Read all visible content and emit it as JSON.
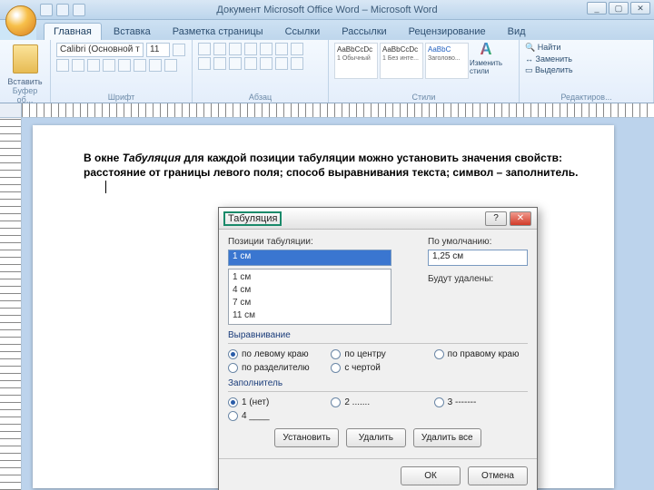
{
  "titlebar": {
    "text": "Документ Microsoft Office Word – Microsoft Word"
  },
  "win": {
    "min": "_",
    "max": "▢",
    "close": "✕"
  },
  "tabs": [
    "Главная",
    "Вставка",
    "Разметка страницы",
    "Ссылки",
    "Рассылки",
    "Рецензирование",
    "Вид"
  ],
  "active_tab": 0,
  "ribbon": {
    "clipboard": {
      "label": "Буфер об...",
      "paste": "Вставить"
    },
    "font": {
      "label": "Шрифт",
      "name": "Calibri (Основной т",
      "size": "11"
    },
    "paragraph": {
      "label": "Абзац"
    },
    "styles": {
      "label": "Стили",
      "preview_text": "AaBbCcDc",
      "preview_h": "AaBbC",
      "names": [
        "1 Обычный",
        "1 Без инте...",
        "Заголово..."
      ],
      "change": "Изменить стили"
    },
    "editing": {
      "label": "Редактиров...",
      "find": "Найти",
      "replace": "Заменить",
      "select": "Выделить"
    }
  },
  "document": {
    "p1": "В окне ",
    "p1_i": "Табуляция",
    "p1_b": " для каждой позиции табуляции можно установить значения свойств: расстояние от границы левого поля; способ выравнивания текста; символ – заполнитель."
  },
  "dialog": {
    "title": "Табуляция",
    "help": "?",
    "close": "✕",
    "pos_label": "Позиции табуляции:",
    "pos_value": "1 см",
    "default_label": "По умолчанию:",
    "default_value": "1,25 см",
    "remove_label": "Будут удалены:",
    "list": [
      "1 см",
      "4 см",
      "7 см",
      "11 см"
    ],
    "align_label": "Выравнивание",
    "align": {
      "left": "по левому краю",
      "center": "по центру",
      "right": "по правому краю",
      "decimal": "по разделителю",
      "bar": "с чертой"
    },
    "leader_label": "Заполнитель",
    "leader": {
      "none": "1 (нет)",
      "dots": "2 .......",
      "dashes": "3 -------",
      "under": "4 ____"
    },
    "set": "Установить",
    "clear": "Удалить",
    "clear_all": "Удалить все",
    "ok": "ОК",
    "cancel": "Отмена"
  }
}
